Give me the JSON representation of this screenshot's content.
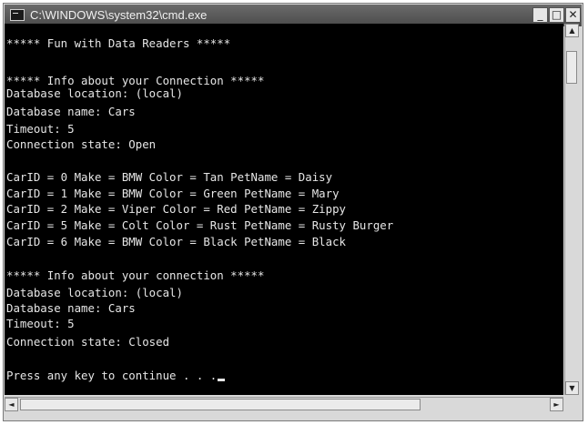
{
  "window": {
    "title": "C:\\WINDOWS\\system32\\cmd.exe",
    "minimize_label": "_",
    "maximize_label": "□",
    "close_label": "✕"
  },
  "console": {
    "lines": [
      "***** Fun with Data Readers *****",
      "",
      "***** Info about your Connection *****",
      "Database location: (local)",
      "Database name: Cars",
      "Timeout: 5",
      "Connection state: Open",
      "",
      "CarID = 0 Make = BMW Color = Tan PetName = Daisy",
      "CarID = 1 Make = BMW Color = Green PetName = Mary",
      "CarID = 2 Make = Viper Color = Red PetName = Zippy",
      "CarID = 5 Make = Colt Color = Rust PetName = Rusty Burger",
      "CarID = 6 Make = BMW Color = Black PetName = Black",
      "",
      "***** Info about your connection *****",
      "Database location: (local)",
      "Database name: Cars",
      "Timeout: 5",
      "Connection state: Closed",
      "",
      "Press any key to continue . . ."
    ]
  },
  "scrollbars": {
    "up_arrow": "▲",
    "down_arrow": "▼",
    "left_arrow": "◄",
    "right_arrow": "►"
  }
}
